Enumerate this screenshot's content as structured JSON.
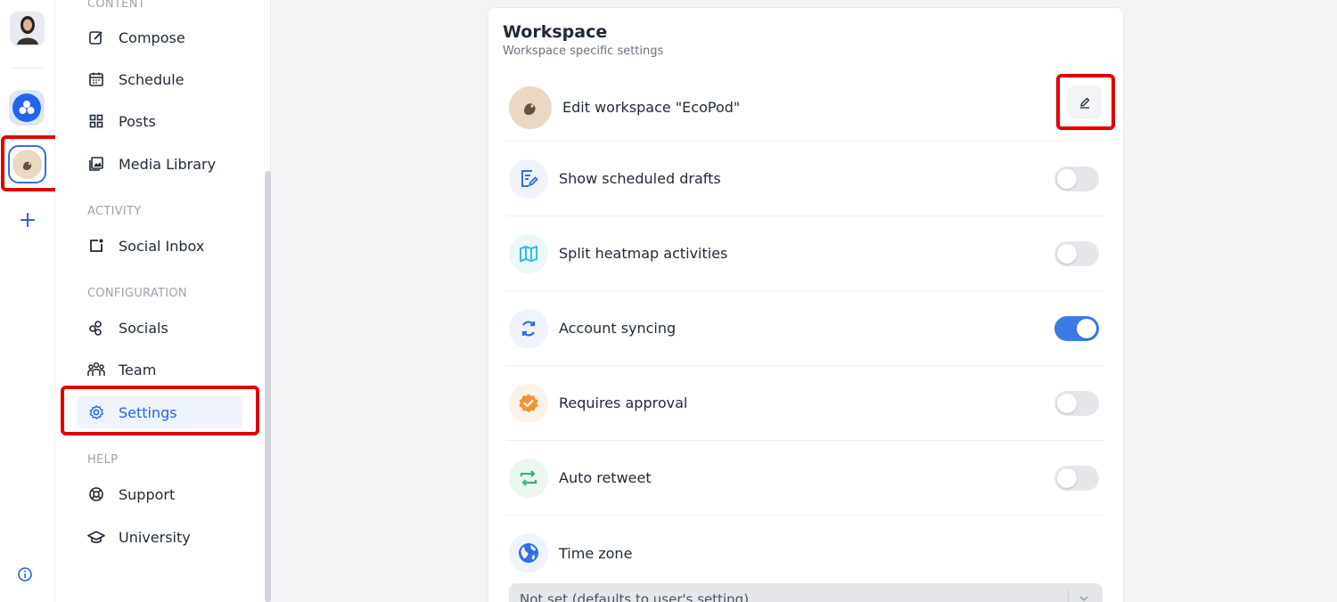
{
  "sidebar": {
    "sections": {
      "content": "CONTENT",
      "activity": "ACTIVITY",
      "configuration": "CONFIGURATION",
      "help": "HELP"
    },
    "items": {
      "compose": "Compose",
      "schedule": "Schedule",
      "posts": "Posts",
      "media": "Media Library",
      "inbox": "Social Inbox",
      "socials": "Socials",
      "team": "Team",
      "settings": "Settings",
      "support": "Support",
      "university": "University"
    },
    "active_item": "settings"
  },
  "workspace": {
    "title": "Workspace",
    "subtitle": "Workspace specific settings",
    "edit_label": "Edit workspace \"EcoPod\"",
    "settings": [
      {
        "key": "scheduled_drafts",
        "label": "Show scheduled drafts",
        "enabled": false,
        "icon": "drafts-icon"
      },
      {
        "key": "split_heatmap",
        "label": "Split heatmap activities",
        "enabled": false,
        "icon": "map-icon"
      },
      {
        "key": "account_syncing",
        "label": "Account syncing",
        "enabled": true,
        "icon": "sync-icon"
      },
      {
        "key": "requires_approval",
        "label": "Requires approval",
        "enabled": false,
        "icon": "approval-badge-icon"
      },
      {
        "key": "auto_retweet",
        "label": "Auto retweet",
        "enabled": false,
        "icon": "retweet-icon"
      }
    ],
    "timezone": {
      "label": "Time zone",
      "value": "Not set (defaults to user's setting)"
    }
  },
  "colors": {
    "accent": "#2563eb",
    "highlight": "#e00000",
    "toggle_on": "#3b7be8"
  }
}
